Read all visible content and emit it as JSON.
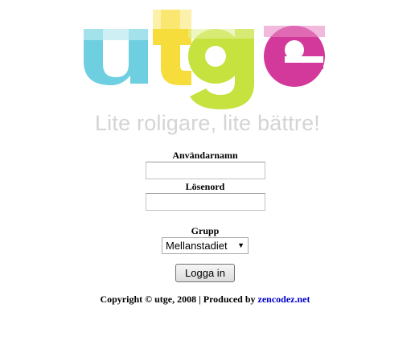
{
  "logo": {
    "text": "utge",
    "letters": [
      {
        "char": "u",
        "color": "#6ecfe0"
      },
      {
        "char": "t",
        "color": "#f7dd3c"
      },
      {
        "char": "g",
        "color": "#c6e23e"
      },
      {
        "char": "e",
        "color": "#d2399a"
      }
    ]
  },
  "slogan": "Lite roligare, lite bättre!",
  "form": {
    "username_label": "Användarnamn",
    "username_value": "",
    "password_label": "Lösenord",
    "password_value": "",
    "group_label": "Grupp",
    "group_selected": "Mellanstadiet",
    "login_button": "Logga in"
  },
  "footer": {
    "copyright": "Copyright © utge, 2008 | Produced by ",
    "link_text": "zencodez.net"
  }
}
